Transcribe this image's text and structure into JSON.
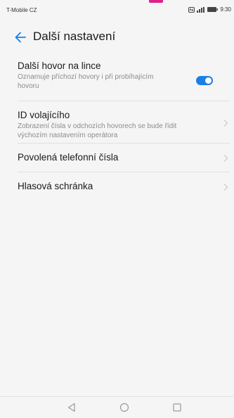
{
  "status_bar": {
    "carrier": "T-Mobile CZ",
    "time": "9:30"
  },
  "header": {
    "title": "Další nastavení"
  },
  "settings": [
    {
      "title": "Další hovor na lince",
      "subtitle": "Oznamuje příchozí hovory i při probíhajícím hovoru",
      "control": "toggle",
      "toggle_on": true
    },
    {
      "title": "ID volajícího",
      "subtitle": "Zobrazení čísla v odchozích hovorech se bude řídit výchozím nastavením operátora",
      "control": "chevron"
    },
    {
      "title": "Povolená telefonní čísla",
      "control": "chevron"
    },
    {
      "title": "Hlasová schránka",
      "control": "chevron"
    }
  ],
  "navigation": {
    "buttons": [
      "back-triangle-icon",
      "home-circle-icon",
      "recent-apps-square-icon"
    ]
  },
  "colors": {
    "accent": "#1a7fe8",
    "marker": "#e0218a",
    "background": "#f5f5f5"
  }
}
